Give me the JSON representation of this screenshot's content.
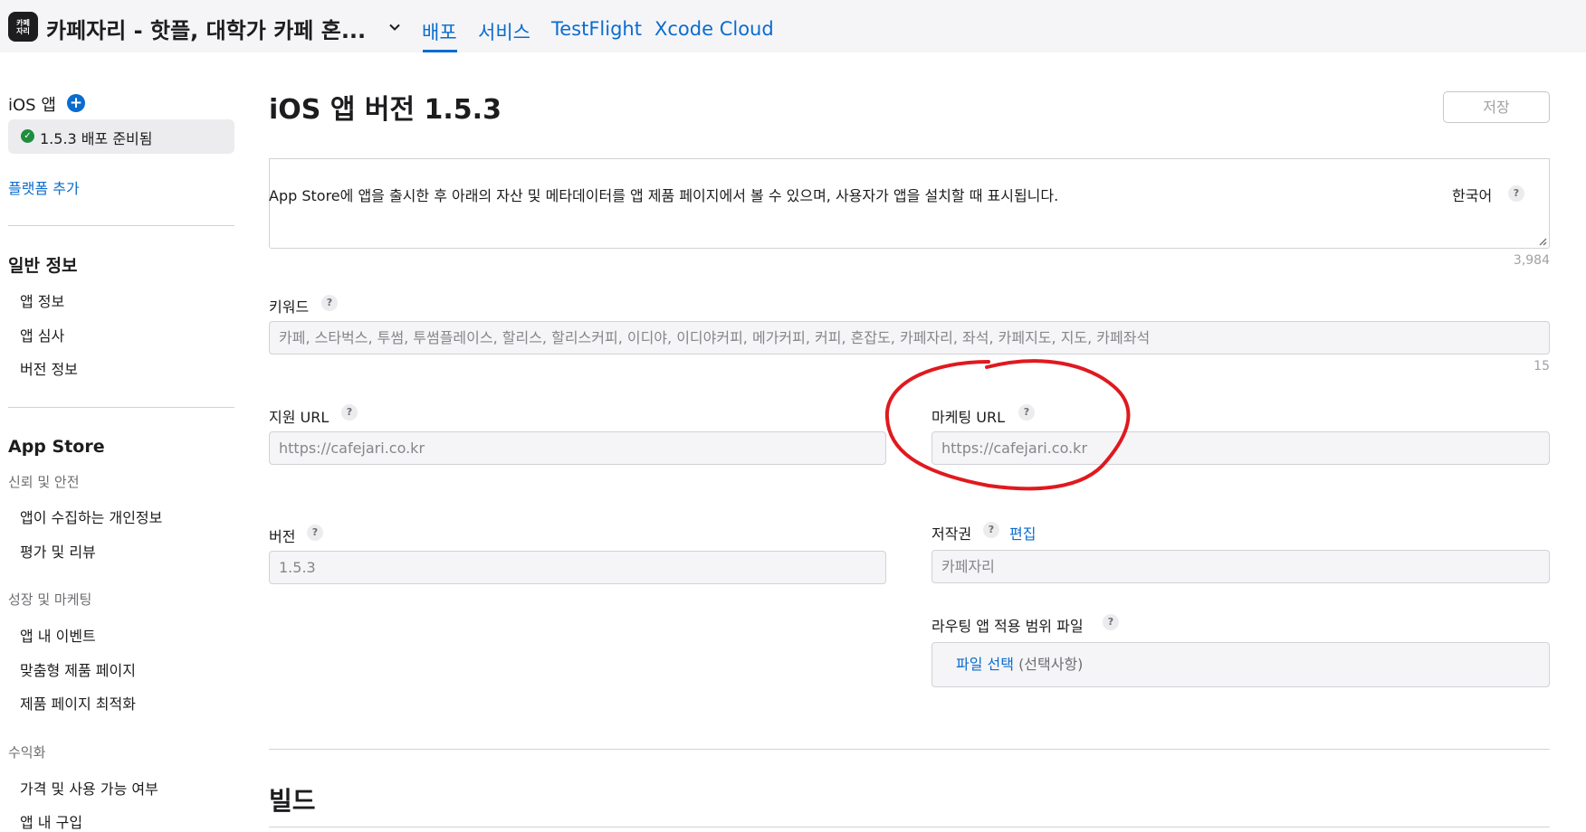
{
  "header": {
    "app_icon_text": "카페\n자리",
    "app_title": "카페자리 - 핫플, 대학가 카페 혼...",
    "tabs": [
      "배포",
      "서비스",
      "TestFlight",
      "Xcode Cloud"
    ]
  },
  "sidebar": {
    "ios_app_label": "iOS 앱",
    "version_item": "1.5.3 배포 준비됨",
    "add_platform": "플랫폼 추가",
    "general_heading": "일반 정보",
    "general_items": [
      "앱 정보",
      "앱 심사",
      "버전 정보"
    ],
    "appstore_heading": "App Store",
    "trust_category": "신뢰 및 안전",
    "trust_items": [
      "앱이 수집하는 개인정보",
      "평가 및 리뷰"
    ],
    "growth_category": "성장 및 마케팅",
    "growth_items": [
      "앱 내 이벤트",
      "맞춤형 제품 페이지",
      "제품 페이지 최적화"
    ],
    "monetization_category": "수익화",
    "monetization_items": [
      "가격 및 사용 가능 여부",
      "앱 내 구입"
    ]
  },
  "main": {
    "page_title": "iOS 앱 버전 1.5.3",
    "save_button": "저장",
    "description": "App Store에 앱을 출시한 후 아래의 자산 및 메타데이터를 앱 제품 페이지에서 볼 수 있으며, 사용자가 앱을 설치할 때 표시됩니다.",
    "language": "한국어",
    "promo_counter": "3,984",
    "keywords_label": "키워드",
    "keywords_value": "카페, 스타벅스, 투썸, 투썸플레이스, 할리스, 할리스커피, 이디야, 이디야커피, 메가커피, 커피, 혼잡도, 카페자리, 좌석, 카페지도, 지도, 카페좌석",
    "keywords_counter": "15",
    "support_url_label": "지원 URL",
    "support_url_value": "https://cafejari.co.kr",
    "marketing_url_label": "마케팅 URL",
    "marketing_url_value": "https://cafejari.co.kr",
    "version_label": "버전",
    "version_value": "1.5.3",
    "copyright_label": "저작권",
    "copyright_edit": "편집",
    "copyright_value": "카페자리",
    "routing_label": "라우팅 앱 적용 범위 파일",
    "routing_choose": "파일 선택",
    "routing_optional": "(선택사항)",
    "build_heading": "빌드",
    "help_glyph": "?"
  },
  "colors": {
    "accent": "#0a6ccf",
    "annotation": "#e0191e",
    "status_ok": "#1e8e3e"
  }
}
